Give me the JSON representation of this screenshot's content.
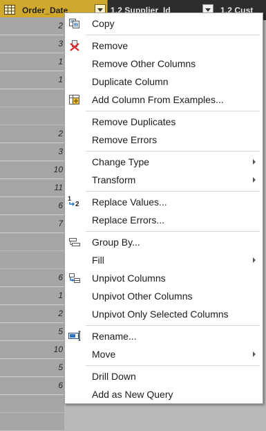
{
  "header": {
    "col1": {
      "title": "Order_Date"
    },
    "col2": {
      "title": "1.2 Supplier_Id"
    },
    "col3": {
      "title": "1.2 Cust"
    }
  },
  "column_cells": [
    "2",
    "3",
    "1",
    "1",
    "",
    "",
    "2",
    "3",
    "10",
    "11",
    "6",
    "7",
    "",
    "",
    "6",
    "1",
    "2",
    "5",
    "10",
    "5",
    "6",
    "",
    ""
  ],
  "menu": {
    "items": [
      {
        "label": "Copy",
        "icon": "copy-icon"
      },
      {
        "label": "Remove",
        "icon": "remove-column-icon"
      },
      {
        "label": "Remove Other Columns"
      },
      {
        "label": "Duplicate Column"
      },
      {
        "label": "Add Column From Examples...",
        "icon": "add-column-from-examples-icon"
      },
      {
        "label": "Remove Duplicates"
      },
      {
        "label": "Remove Errors"
      },
      {
        "label": "Change Type",
        "submenu": true
      },
      {
        "label": "Transform",
        "submenu": true
      },
      {
        "label": "Replace Values...",
        "icon": "replace-values-icon"
      },
      {
        "label": "Replace Errors..."
      },
      {
        "label": "Group By...",
        "icon": "group-by-icon"
      },
      {
        "label": "Fill",
        "submenu": true
      },
      {
        "label": "Unpivot Columns",
        "icon": "unpivot-columns-icon"
      },
      {
        "label": "Unpivot Other Columns"
      },
      {
        "label": "Unpivot Only Selected Columns"
      },
      {
        "label": "Rename...",
        "icon": "rename-icon"
      },
      {
        "label": "Move",
        "submenu": true
      },
      {
        "label": "Drill Down"
      },
      {
        "label": "Add as New Query"
      }
    ]
  },
  "colors": {
    "selected_header": "#d0a82e",
    "header_dark": "#2d2d2d",
    "column_bg": "#a6a6a6"
  }
}
